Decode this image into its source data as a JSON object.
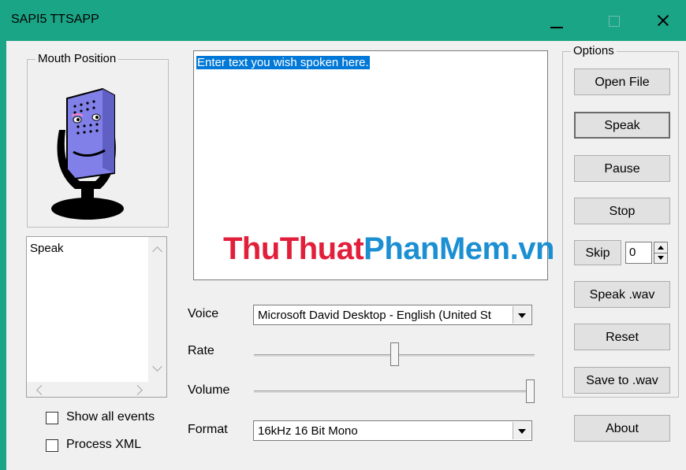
{
  "window": {
    "title": "SAPI5 TTSAPP"
  },
  "mouth_group": {
    "label": "Mouth Position"
  },
  "events": {
    "text": "Speak"
  },
  "checkboxes": {
    "show_all_events": "Show all events",
    "process_xml": "Process XML"
  },
  "text_input": {
    "value": "Enter text you wish spoken here."
  },
  "watermark": {
    "part1": "ThuThuat",
    "part2": "PhanMem.vn"
  },
  "voice": {
    "label": "Voice",
    "selected": "Microsoft David Desktop - English (United St"
  },
  "rate": {
    "label": "Rate",
    "level": 0.5
  },
  "volume": {
    "label": "Volume",
    "level": 1.0
  },
  "format": {
    "label": "Format",
    "selected": "16kHz 16 Bit Mono"
  },
  "options": {
    "label": "Options",
    "open_file": "Open File",
    "speak": "Speak",
    "pause": "Pause",
    "stop": "Stop",
    "skip": "Skip",
    "skip_value": "0",
    "speak_wav": "Speak .wav",
    "reset": "Reset",
    "save_wav": "Save to .wav"
  },
  "about": "About",
  "colors": {
    "titlebar": "#1aa586",
    "selection": "#0078d7",
    "mic_body": "#8080e8",
    "mic_stand": "#000000"
  },
  "icons": [
    "minimize-icon",
    "maximize-icon",
    "close-icon",
    "microphone-mouth-icon",
    "scroll-up-icon",
    "scroll-down-icon",
    "scroll-left-icon",
    "scroll-right-icon",
    "dropdown-arrow-icon",
    "spin-up-icon",
    "spin-down-icon"
  ]
}
